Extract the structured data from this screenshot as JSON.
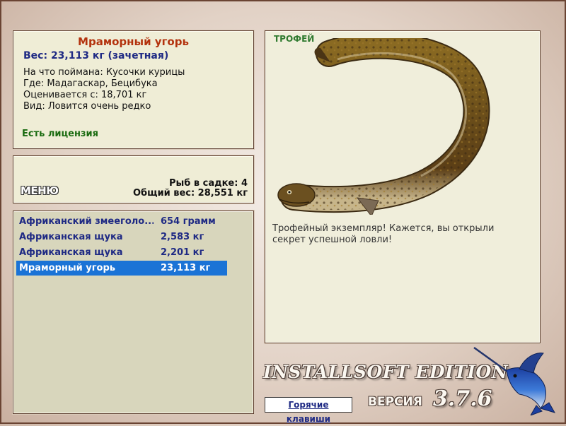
{
  "fish": {
    "name": "Мраморный угорь",
    "weight": "Вес: 23,113 кг (зачетная)",
    "bait": "На что поймана: Кусочки курицы",
    "location": "Где: Мадагаскар, Бецибука",
    "rating": "Оценивается с: 18,701 кг",
    "rarity": "Вид: Ловится очень редко",
    "license": "Есть лицензия"
  },
  "menu_label": "МЕНЮ",
  "keepnet": {
    "count": "Рыб в садке: 4",
    "total_weight": "Общий вес: 28,551 кг"
  },
  "catch_list": [
    {
      "name": "Африканский змееголо...",
      "weight": "654 грамм"
    },
    {
      "name": "Африканская щука",
      "weight": "2,583 кг"
    },
    {
      "name": "Африканская щука",
      "weight": "2,201 кг"
    },
    {
      "name": "Мраморный угорь",
      "weight": "23,113 кг"
    }
  ],
  "selected_index": 3,
  "trophy": {
    "tag": "ТРОФЕЙ",
    "message": "Трофейный экземпляр! Кажется, вы открыли секрет успешной ловли!"
  },
  "branding": {
    "edition": "INSTALLSOFT EDITION",
    "version_label": "ВЕРСИЯ",
    "version": "3.7.6"
  },
  "hotkeys_label": "Горячие клавиши",
  "colors": {
    "panel": "#efedd6",
    "list_bg": "#d8d6bc",
    "selection": "#1a73d6",
    "title": "#b3320d",
    "list_text": "#1f2a84",
    "license": "#1a6b10"
  },
  "icons": [
    "eel-image",
    "marlin-image"
  ]
}
